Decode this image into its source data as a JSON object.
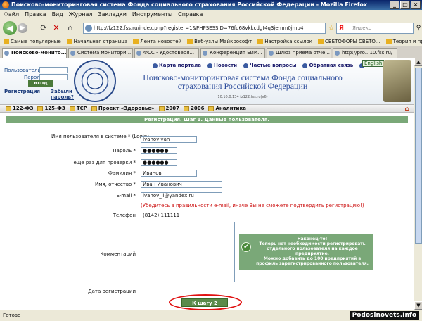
{
  "window": {
    "title": "Поисково-мониторинговая система Фонда социального страхования Российской Федерации - Mozilla Firefox"
  },
  "menu": [
    "Файл",
    "Правка",
    "Вид",
    "Журнал",
    "Закладки",
    "Инструменты",
    "Справка"
  ],
  "nav": {
    "url": "http://fz122.fss.ru/index.php?register=1&PHPSESSID=76fo68vkkcdgt4q3jemm0jmu4",
    "search_placeholder": "Яндекс"
  },
  "bookmarks": [
    "Самые популярные",
    "Начальная страница",
    "Лента новостей",
    "Веб-узлы Майкрософт",
    "Настройка ссылок",
    "СВЕТОФОРЫ СВЕТО...",
    "Теория и практика п..."
  ],
  "tabs": [
    "Поисково-монито...",
    "Система монитори...",
    "ФСС - Удостоверя...",
    "Конференция ЕИИ...",
    "Шлюз приема отче...",
    "http://pro...10.fss.ru/"
  ],
  "header": {
    "user_label": "Пользователь:",
    "password_label": "Пароль:",
    "login_button": "вход",
    "register_link": "Регистрация",
    "forgot_link": "Забыли пароль?",
    "links": [
      "Карта портала",
      "Новости",
      "Частые вопросы",
      "Обратная связь",
      "Помощь"
    ],
    "english": "English",
    "title": "Поисково-мониторинговая система Фонда социального страхования Российской Федерации",
    "version": "10.10.0.134 fz122.fss.ru(v6)"
  },
  "section_menu": [
    "122-ФЗ",
    "125-ФЗ",
    "ТСР",
    "Проект «Здоровье»",
    "2007",
    "2006",
    "Аналитика"
  ],
  "form": {
    "header": "Регистрация. Шаг 1. Данные пользователя.",
    "login_label": "Имя пользователя в системе * (Login)",
    "login_value": "IvanovIvan",
    "password_label": "Пароль *",
    "password_value": "●●●●●●",
    "password2_label": "еще раз для проверки *",
    "password2_value": "●●●●●●",
    "lastname_label": "Фамилия *",
    "lastname_value": "Иванов",
    "firstname_label": "Имя, отчество *",
    "firstname_value": "Иван Иванович",
    "email_label": "E-mail *",
    "email_value": "ivanov_ii@yandex.ru",
    "email_hint": "(Убедитесь в правильности e-mail, иначе Вы не сможете подтвердить регистрацию!)",
    "phone_label": "Телефон",
    "phone_value": "(8142) 111111",
    "comment_label": "Комментарий",
    "date_label": "Дата регистрации",
    "submit": "К шагу 2"
  },
  "notice": {
    "line1": "Наконец-то!",
    "line2": "Теперь нет необходимости регистрировать отдельного пользователя на каждое предприятие.",
    "line3": "Можно добавить до 100 предприятий в профиль зарегистрированного пользователя."
  },
  "status": "Готово",
  "watermark": "Podosinovets.Info",
  "colors": {
    "accent_green": "#7aa878",
    "title_blue": "#2a4a9a",
    "highlight_red": "#e01010"
  }
}
